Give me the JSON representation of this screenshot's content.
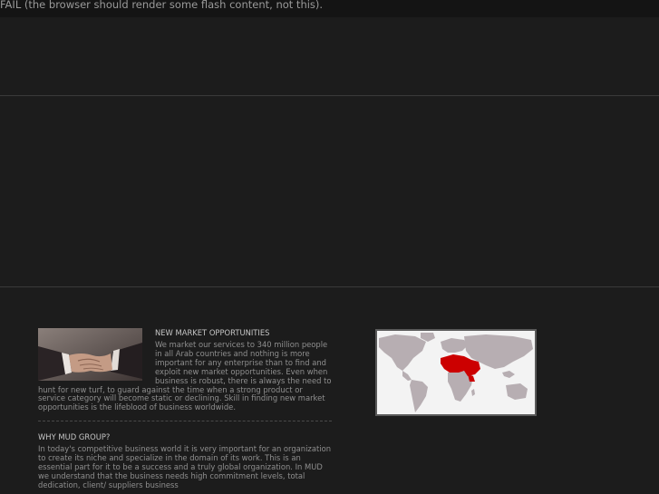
{
  "flash_notice": "FAIL (the browser should render some flash content, not this).",
  "section_market": {
    "title": "NEW MARKET OPPORTUNITIES",
    "body": "We market our services to 340 million people in all Arab countries and nothing is more important for any enterprise than to find and exploit new market opportunities. Even when business is robust, there is always the need to hunt for new turf, to guard against the time when a strong product or service category will become static or declining.  Skill in finding new market opportunities is the lifeblood of business worldwide."
  },
  "section_why": {
    "title": "WHY MUD GROUP?",
    "body": "In today's competitive business world it is very important for an organization to create its niche and specialize in the domain of its work. This is an essential part for it to be a success and a truly global organization. In MUD we understand that the business needs high commitment levels, total dedication, client/ suppliers business"
  },
  "colors": {
    "background": "#1c1c1c",
    "map_highlight": "#cc0000",
    "map_land": "#b7aeb2",
    "map_sea": "#f3f3f3"
  },
  "icons": {
    "handshake": "handshake-photo",
    "map": "world-map-arab-region"
  }
}
